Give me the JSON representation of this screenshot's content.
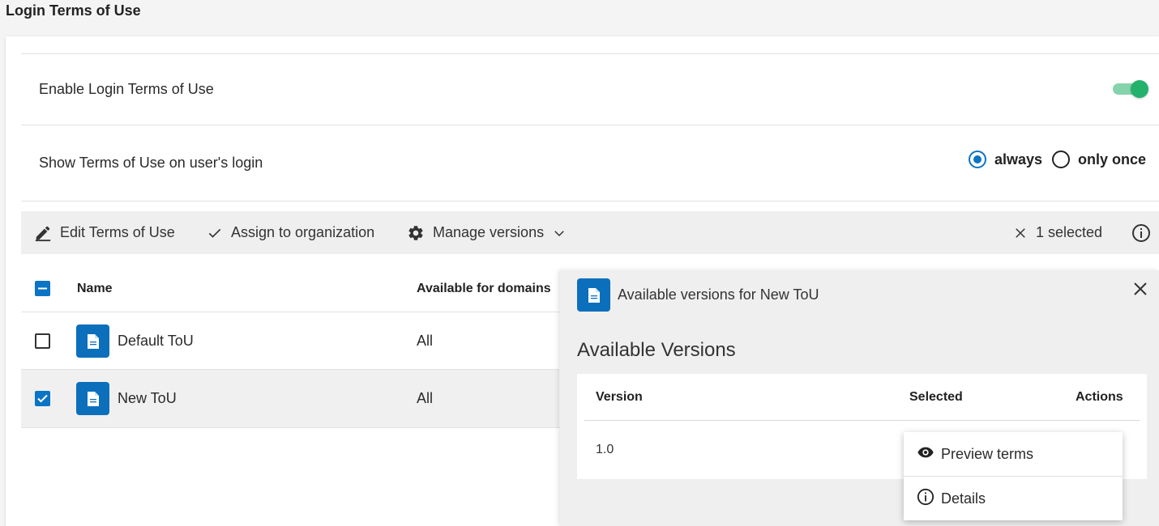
{
  "page": {
    "title": "Login Terms of Use"
  },
  "settings": {
    "enable_label": "Enable Login Terms of Use",
    "enable_value": true,
    "show_label": "Show Terms of Use on user's login",
    "show_options": [
      {
        "label": "always",
        "checked": true
      },
      {
        "label": "only once",
        "checked": false
      }
    ]
  },
  "toolbar": {
    "edit_label": "Edit Terms of Use",
    "assign_label": "Assign to organization",
    "manage_label": "Manage versions",
    "selected_label": "1 selected"
  },
  "table": {
    "columns": {
      "name": "Name",
      "domains": "Available for domains"
    },
    "rows": [
      {
        "name": "Default ToU",
        "domains": "All",
        "checked": false
      },
      {
        "name": "New ToU",
        "domains": "All",
        "checked": true
      }
    ]
  },
  "panel": {
    "title": "Available versions for New ToU",
    "heading": "Available Versions",
    "columns": {
      "version": "Version",
      "selected": "Selected",
      "actions": "Actions"
    },
    "rows": [
      {
        "version": "1.0"
      }
    ]
  },
  "menu": {
    "preview_label": "Preview terms",
    "details_label": "Details"
  },
  "colors": {
    "accent": "#0b74c4",
    "toggle_on": "#23b26b",
    "toggle_track": "#85d3ac"
  }
}
